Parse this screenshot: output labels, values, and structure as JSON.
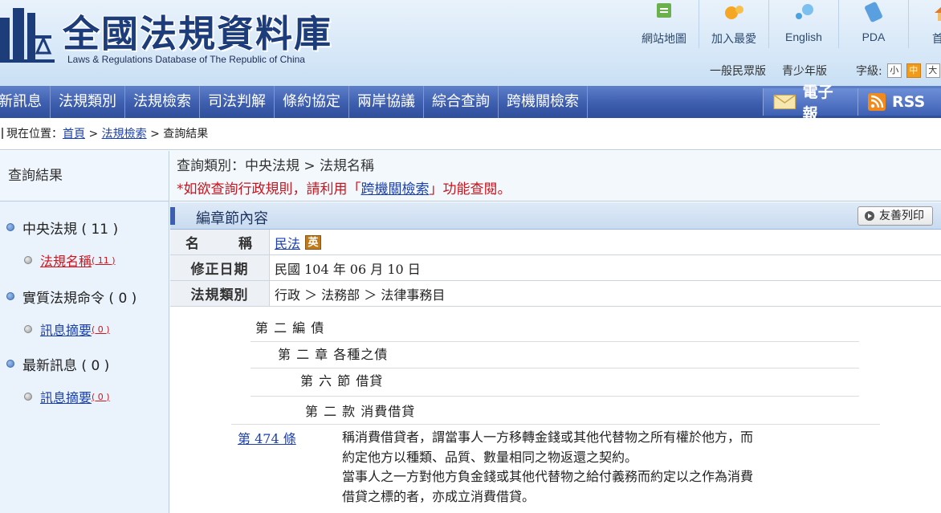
{
  "header": {
    "logo_cn": "全國法規資料庫",
    "logo_en": "Laws & Regulations Database of The Republic of China",
    "top_links": [
      {
        "label": "網站地圖",
        "icon": "sitemap-icon"
      },
      {
        "label": "加入最愛",
        "icon": "favorite-icon"
      },
      {
        "label": "English",
        "icon": "english-icon"
      },
      {
        "label": "PDA",
        "icon": "pda-icon"
      },
      {
        "label": "首頁",
        "icon": "home-icon"
      }
    ],
    "sub_links": [
      "一般民眾版",
      "青少年版"
    ],
    "font_size_label": "字級:",
    "font_sizes": [
      "小",
      "中",
      "大"
    ]
  },
  "nav": {
    "items": [
      "新訊息",
      "法規類別",
      "法規檢索",
      "司法判解",
      "條約協定",
      "兩岸協議",
      "綜合查詢",
      "跨機關檢索"
    ],
    "epaper": "電子報",
    "rss": "RSS"
  },
  "breadcrumb": {
    "prefix": "現在位置：",
    "home": "首頁",
    "sep1": " > ",
    "search": "法規檢索",
    "sep2": " > ",
    "current": "查詢結果"
  },
  "sidebar": {
    "title": "查詢結果",
    "cat1": "中央法規 ( 11 )",
    "cat1_sub": "法規名稱",
    "cat1_sub_count": "( 11 )",
    "cat2": "實質法規命令 ( 0 )",
    "cat2_sub": "訊息摘要",
    "cat2_sub_count": "( 0 )",
    "cat3": "最新訊息 ( 0 )",
    "cat3_sub": "訊息摘要",
    "cat3_sub_count": "( 0 )"
  },
  "query": {
    "category": "查詢類別：中央法規 > 法規名稱",
    "notice_pre": "*如欲查詢行政規則，請利用「",
    "notice_link": "跨機關檢索",
    "notice_post": "」功能查閱。"
  },
  "section": {
    "title": "編章節內容",
    "print": "友善列印"
  },
  "info": {
    "name_label": "名　稱",
    "name_value": "民法",
    "en_badge": "英",
    "date_label": "修正日期",
    "date_value": "民國 104 年 06 月 10 日",
    "type_label": "法規類別",
    "type_value": "行政 ＞ 法務部 ＞ 法律事務目"
  },
  "content": {
    "part": "第 二 編 債",
    "chapter": "第 二 章 各種之債",
    "section": "第 六 節 借貸",
    "subsection": "第 二 款 消費借貸",
    "article_no": "第 474 條",
    "article_p1a": "稱消費借貸者，謂當事人一方移轉金錢或其他代替物之所有權於他方，而",
    "article_p1b": "約定他方以種類、品質、數量相同之物返還之契約。",
    "article_p2a": "當事人之一方對他方負金錢或其他代替物之給付義務而約定以之作為消費",
    "article_p2b": "借貸之標的者，亦成立消費借貸。"
  }
}
